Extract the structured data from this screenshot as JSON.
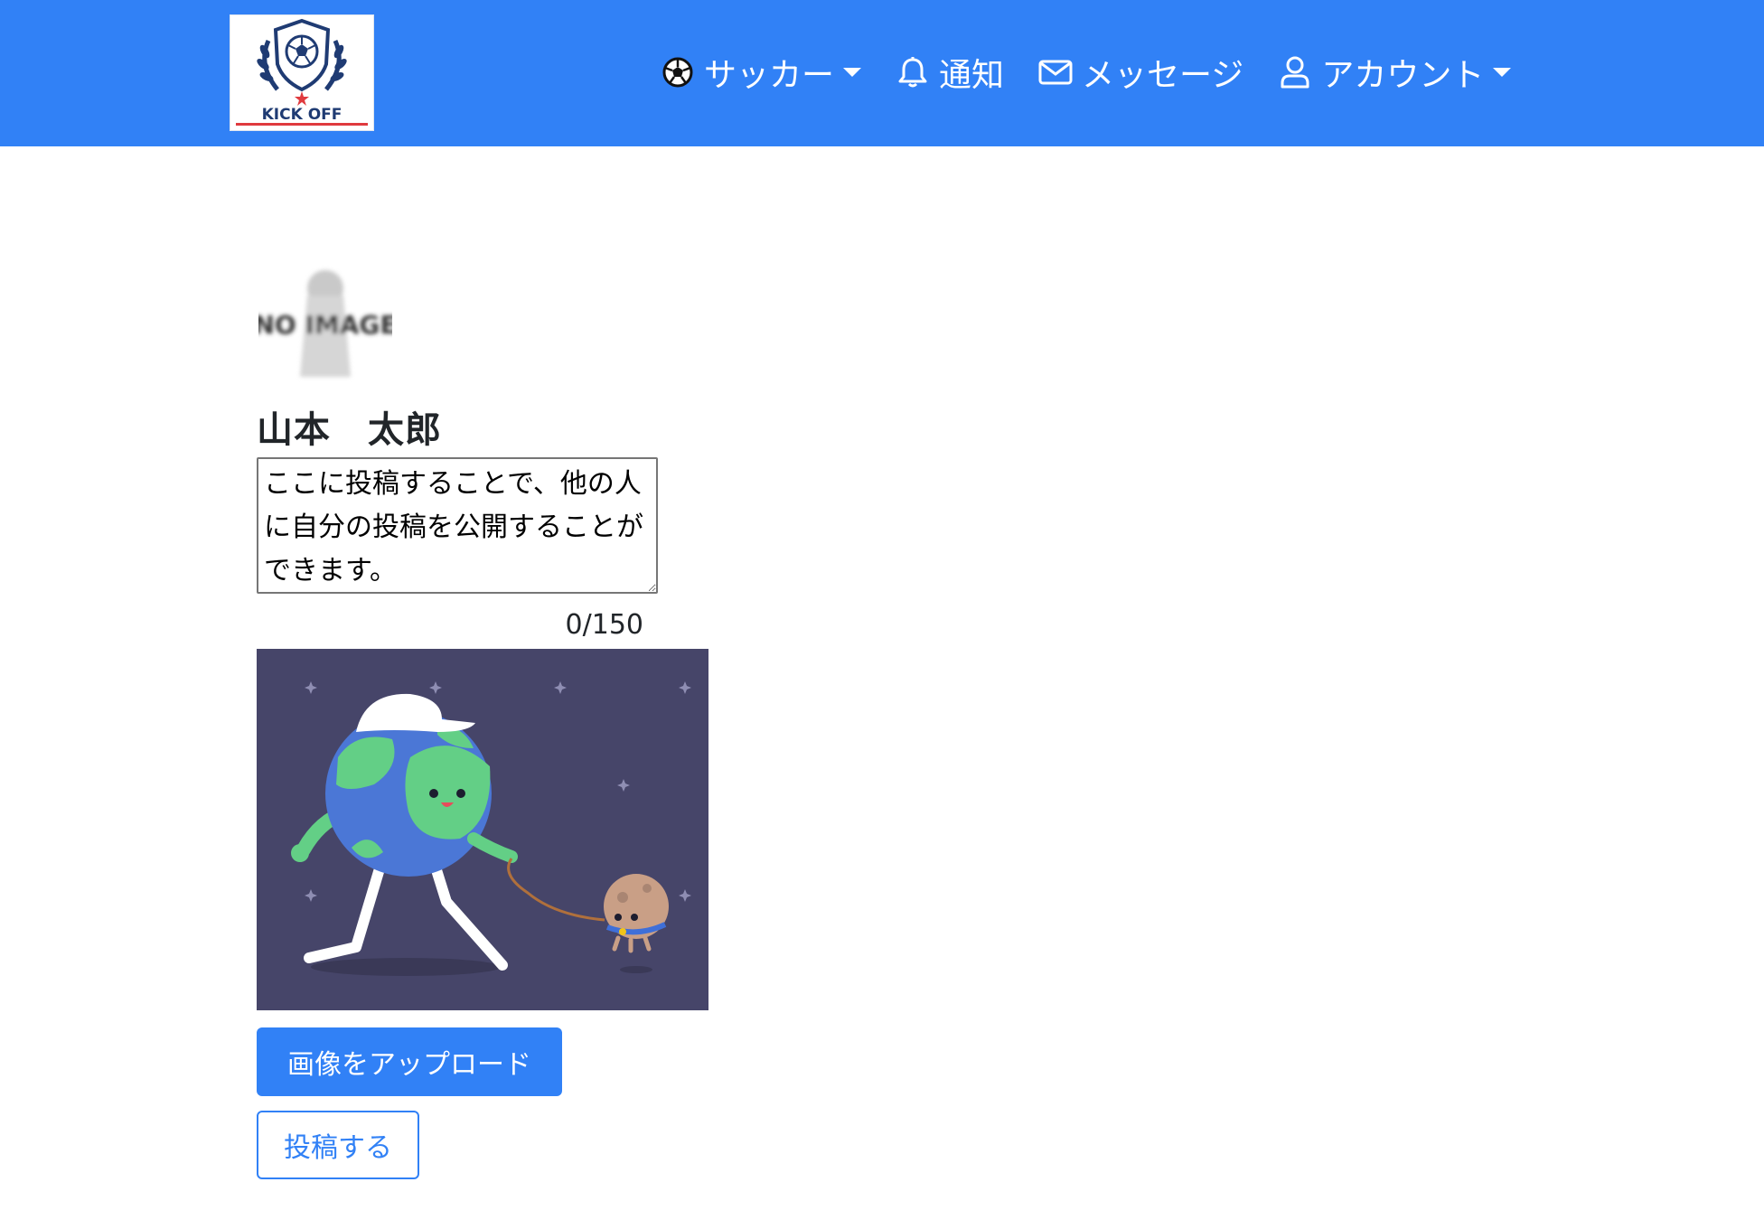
{
  "header": {
    "logo_text": "KICK OFF",
    "nav": [
      {
        "label": "サッカー",
        "icon": "soccer-ball-icon",
        "dropdown": true
      },
      {
        "label": "通知",
        "icon": "bell-icon",
        "dropdown": false
      },
      {
        "label": "メッセージ",
        "icon": "envelope-icon",
        "dropdown": false
      },
      {
        "label": "アカウント",
        "icon": "person-icon",
        "dropdown": true
      }
    ]
  },
  "profile": {
    "avatar_text": "NO IMAGE",
    "name": "山本　太郎"
  },
  "post": {
    "placeholder": "ここに投稿することで、他の人に自分の投稿を公開することができます。",
    "value": "",
    "counter": "0/150"
  },
  "buttons": {
    "upload_label": "画像をアップロード",
    "post_label": "投稿する"
  },
  "colors": {
    "primary": "#3181f6",
    "image_bg": "#464569"
  }
}
